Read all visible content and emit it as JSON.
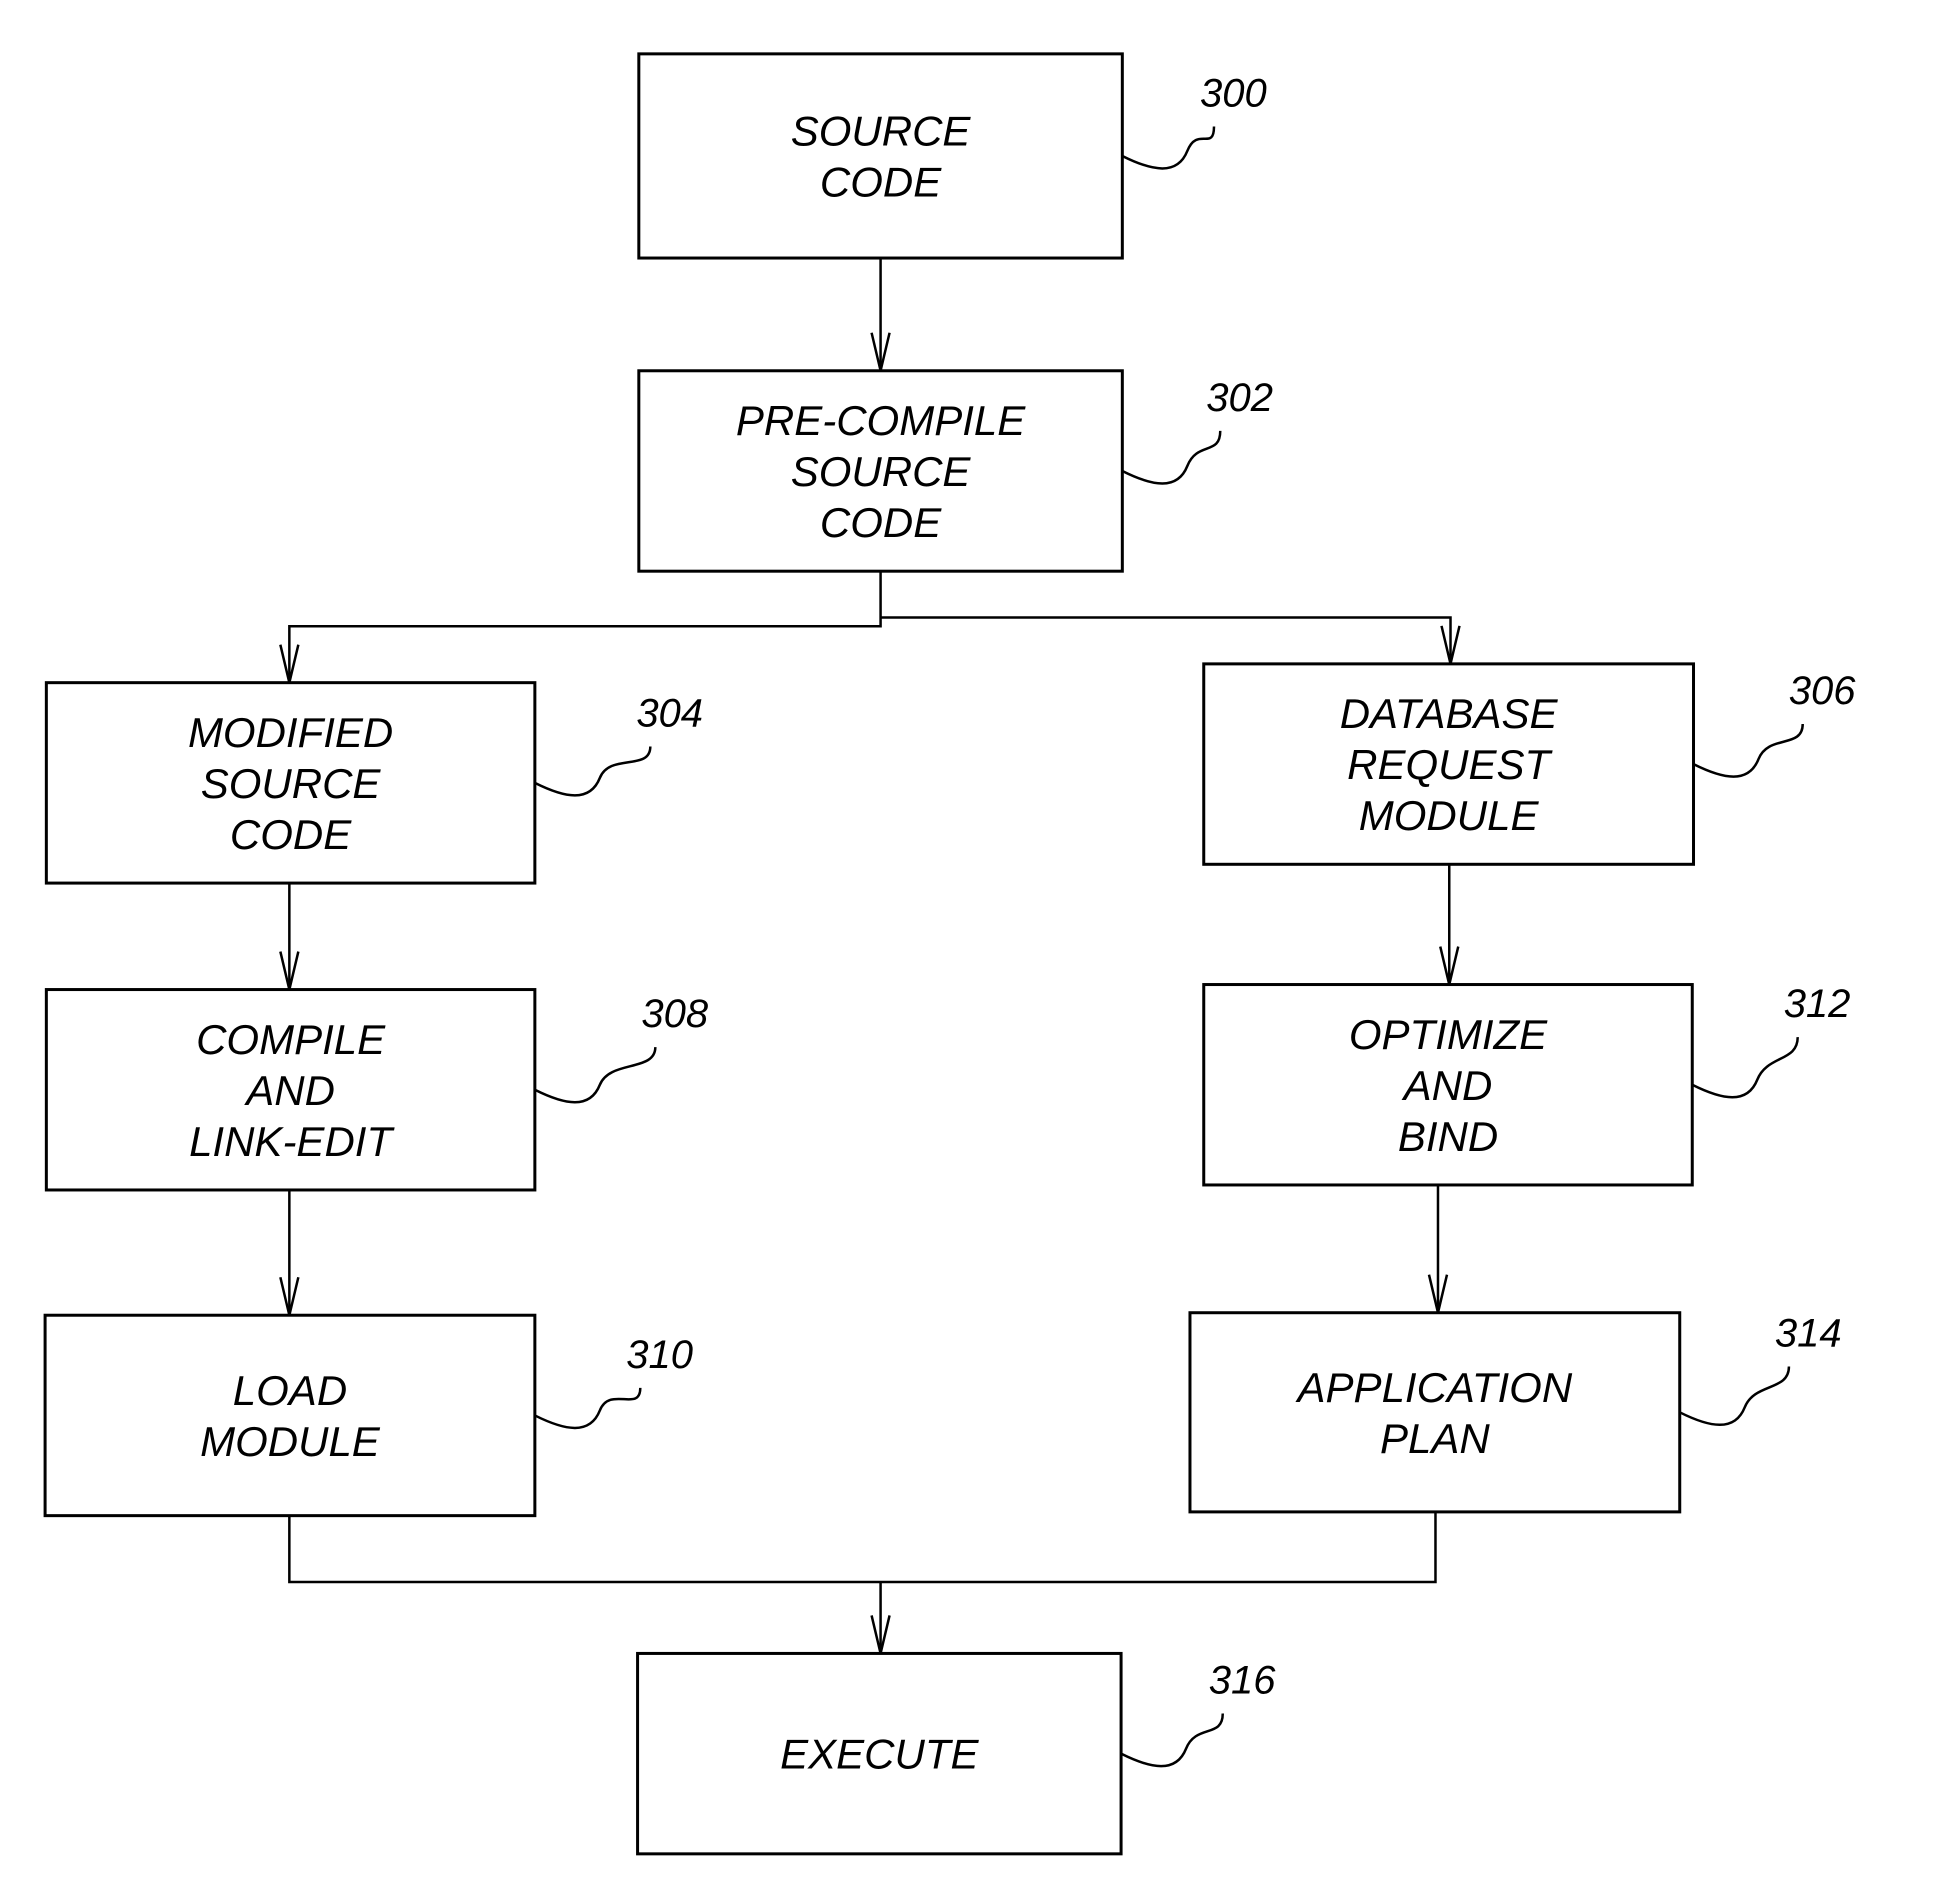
{
  "diagram": {
    "type": "flowchart",
    "nodes": [
      {
        "id": "300",
        "ref": "300",
        "lines": [
          "SOURCE",
          "CODE"
        ]
      },
      {
        "id": "302",
        "ref": "302",
        "lines": [
          "PRE-COMPILE",
          "SOURCE",
          "CODE"
        ]
      },
      {
        "id": "304",
        "ref": "304",
        "lines": [
          "MODIFIED",
          "SOURCE",
          "CODE"
        ]
      },
      {
        "id": "306",
        "ref": "306",
        "lines": [
          "DATABASE",
          "REQUEST",
          "MODULE"
        ]
      },
      {
        "id": "308",
        "ref": "308",
        "lines": [
          "COMPILE",
          "AND",
          "LINK-EDIT"
        ]
      },
      {
        "id": "312",
        "ref": "312",
        "lines": [
          "OPTIMIZE",
          "AND",
          "BIND"
        ]
      },
      {
        "id": "310",
        "ref": "310",
        "lines": [
          "LOAD",
          "MODULE"
        ]
      },
      {
        "id": "314",
        "ref": "314",
        "lines": [
          "APPLICATION",
          "PLAN"
        ]
      },
      {
        "id": "316",
        "ref": "316",
        "lines": [
          "EXECUTE"
        ]
      }
    ],
    "edges": [
      {
        "from": "300",
        "to": "302"
      },
      {
        "from": "302",
        "to": "304"
      },
      {
        "from": "302",
        "to": "306"
      },
      {
        "from": "304",
        "to": "308"
      },
      {
        "from": "308",
        "to": "310"
      },
      {
        "from": "306",
        "to": "312"
      },
      {
        "from": "312",
        "to": "314"
      },
      {
        "from": "310",
        "to": "316"
      },
      {
        "from": "314",
        "to": "316"
      }
    ]
  }
}
